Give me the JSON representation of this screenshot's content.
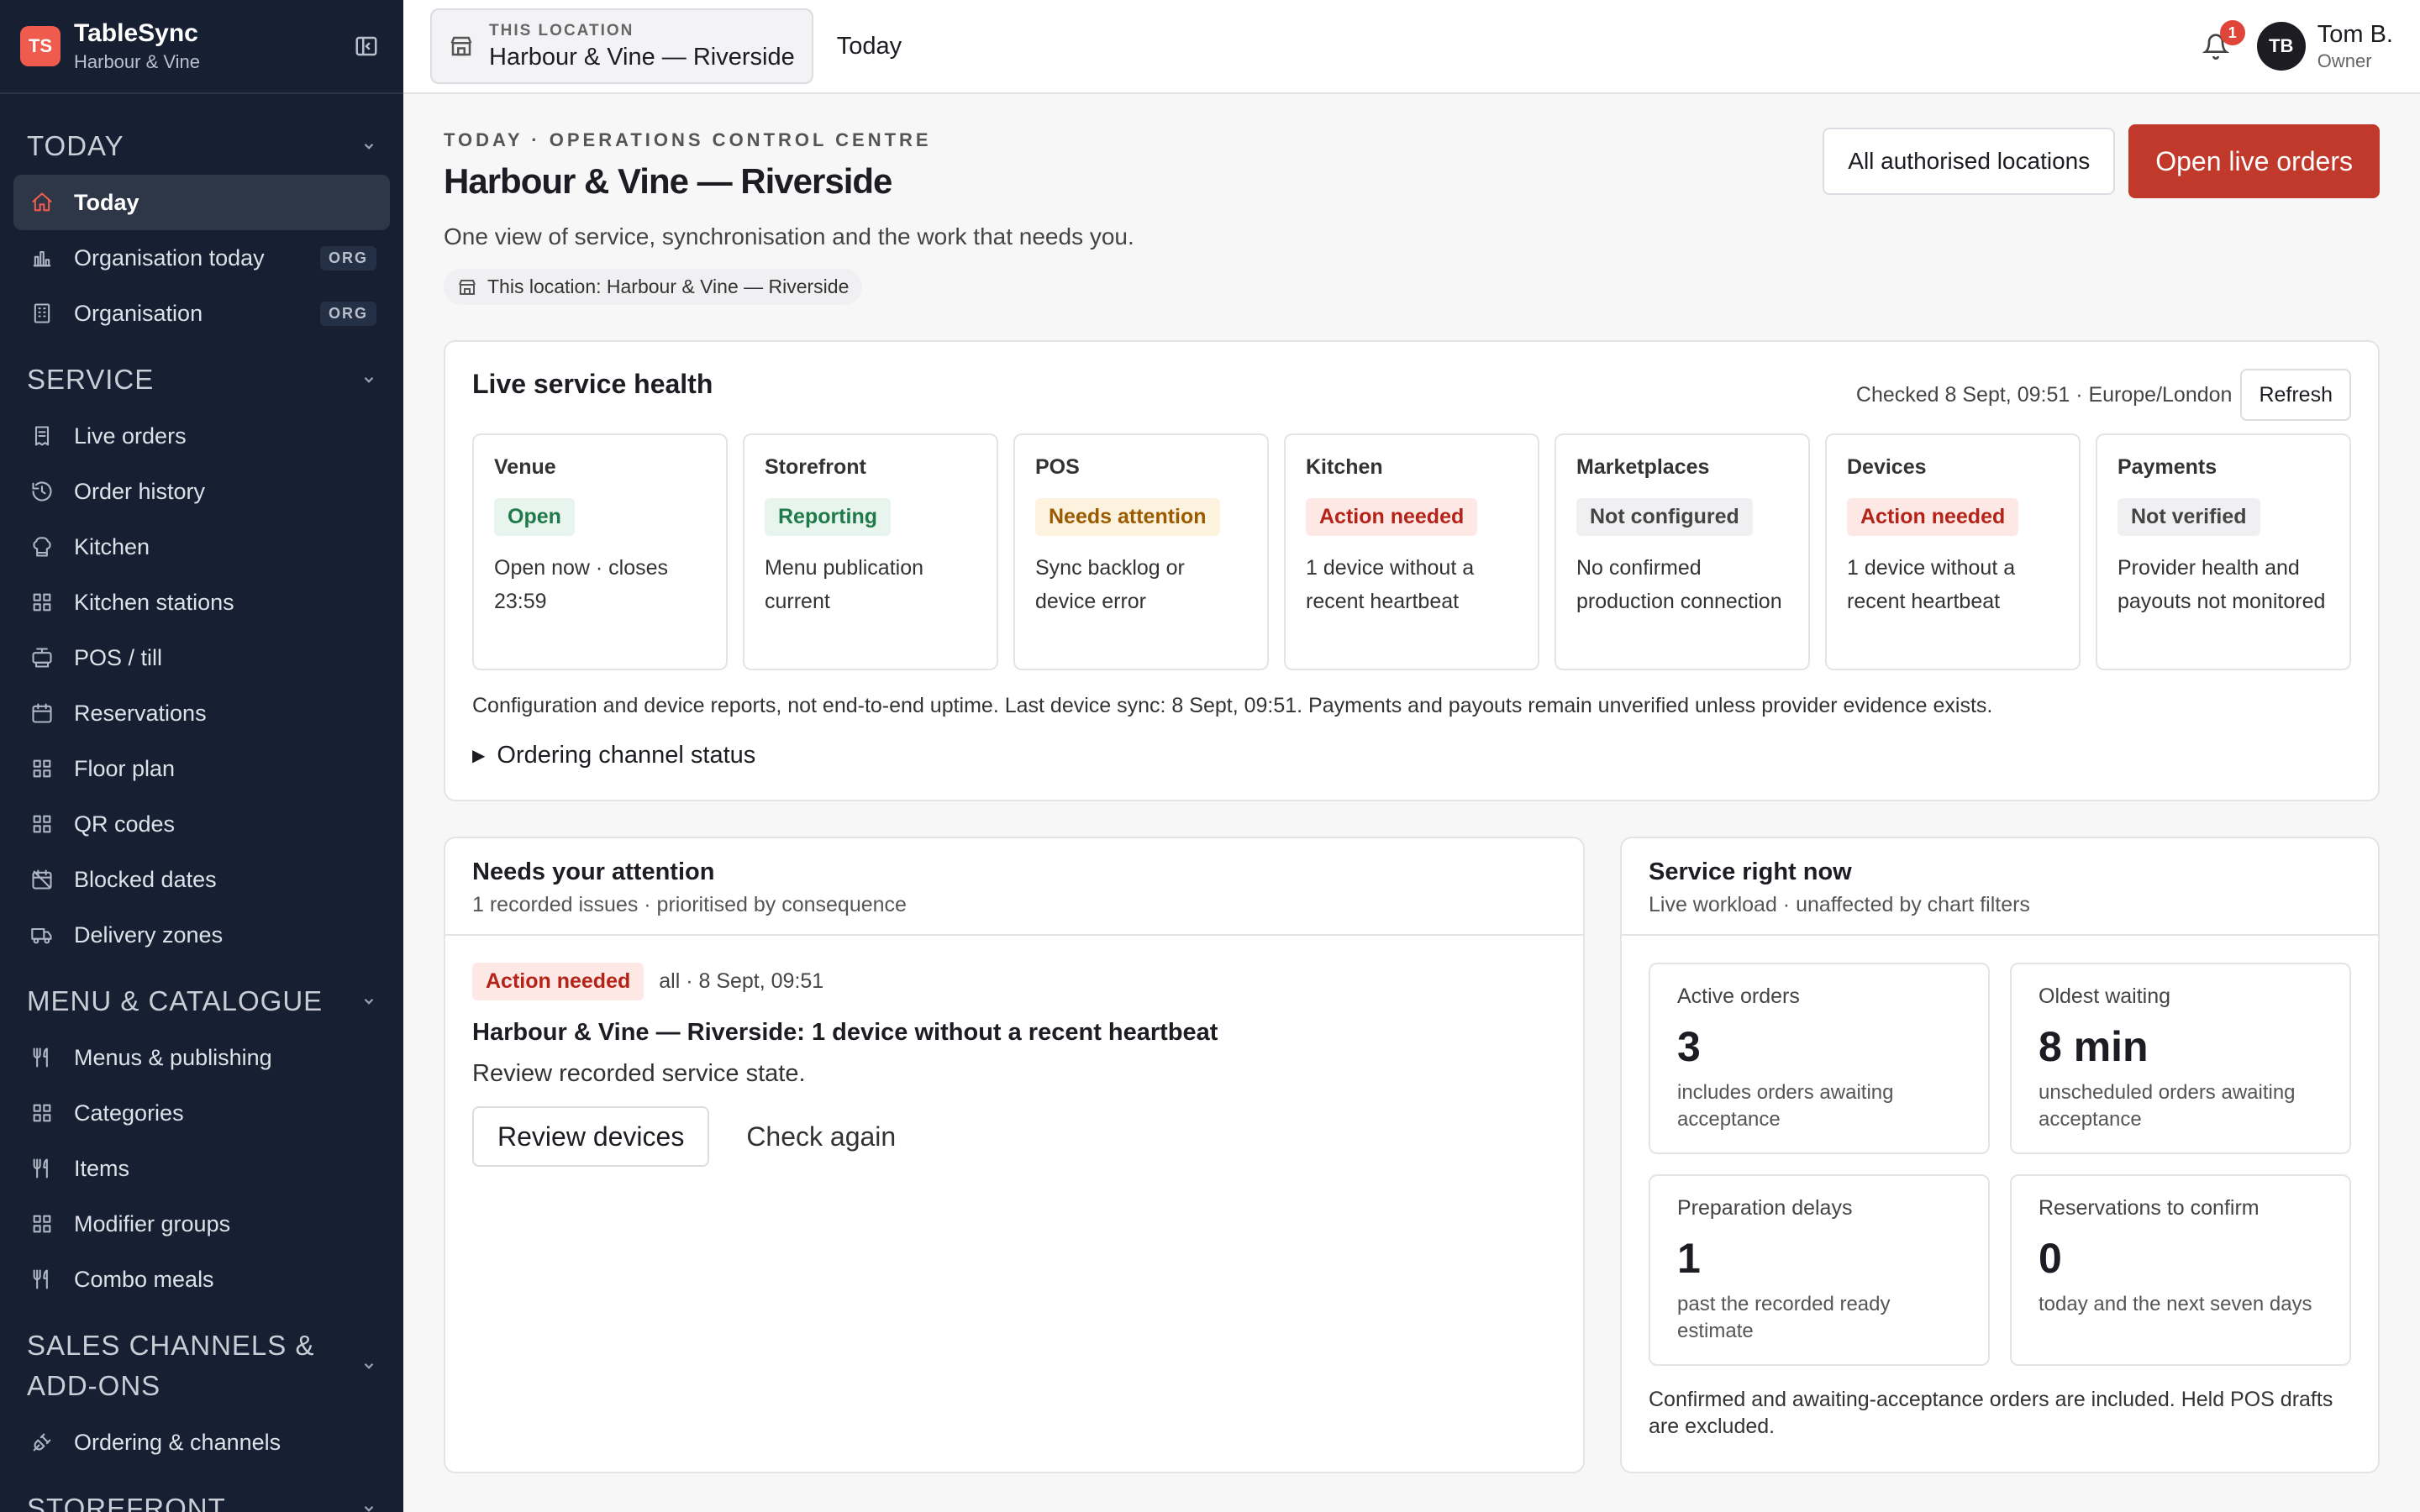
{
  "brand": {
    "initials": "TS",
    "name": "TableSync",
    "subtitle": "Harbour & Vine"
  },
  "sidebar": {
    "sections": [
      {
        "title": "TODAY",
        "items": [
          {
            "label": "Today",
            "icon": "home-icon",
            "active": true
          },
          {
            "label": "Organisation today",
            "icon": "bar-chart-icon",
            "badge": "ORG"
          },
          {
            "label": "Organisation",
            "icon": "building-icon",
            "badge": "ORG"
          }
        ]
      },
      {
        "title": "SERVICE",
        "items": [
          {
            "label": "Live orders",
            "icon": "receipt-icon"
          },
          {
            "label": "Order history",
            "icon": "history-icon"
          },
          {
            "label": "Kitchen",
            "icon": "chef-hat-icon"
          },
          {
            "label": "Kitchen stations",
            "icon": "grid-icon"
          },
          {
            "label": "POS / till",
            "icon": "till-icon"
          },
          {
            "label": "Reservations",
            "icon": "calendar-icon"
          },
          {
            "label": "Floor plan",
            "icon": "grid-icon"
          },
          {
            "label": "QR codes",
            "icon": "grid-icon"
          },
          {
            "label": "Blocked dates",
            "icon": "calendar-off-icon"
          },
          {
            "label": "Delivery zones",
            "icon": "truck-icon"
          }
        ]
      },
      {
        "title": "MENU & CATALOGUE",
        "items": [
          {
            "label": "Menus & publishing",
            "icon": "utensils-icon"
          },
          {
            "label": "Categories",
            "icon": "grid-icon"
          },
          {
            "label": "Items",
            "icon": "utensils-icon"
          },
          {
            "label": "Modifier groups",
            "icon": "grid-icon"
          },
          {
            "label": "Combo meals",
            "icon": "utensils-icon"
          }
        ]
      },
      {
        "title": "SALES CHANNELS & ADD-ONS",
        "items": [
          {
            "label": "Ordering & channels",
            "icon": "plug-icon"
          }
        ]
      },
      {
        "title": "STOREFRONT",
        "items": []
      }
    ]
  },
  "topbar": {
    "location_caption": "THIS LOCATION",
    "location_name": "Harbour & Vine — Riverside",
    "crumb": "Today",
    "notification_count": "1",
    "user_initials": "TB",
    "user_name": "Tom B.",
    "user_role": "Owner"
  },
  "page": {
    "eyebrow": "TODAY · OPERATIONS CONTROL CENTRE",
    "title": "Harbour & Vine — Riverside",
    "subtitle": "One view of service, synchronisation and the work that needs you.",
    "scope_chip": "This location: Harbour & Vine — Riverside",
    "btn_locations": "All authorised locations",
    "btn_live_orders": "Open live orders"
  },
  "health": {
    "title": "Live service health",
    "checked": "Checked 8 Sept, 09:51 · Europe/London",
    "refresh": "Refresh",
    "tiles": [
      {
        "name": "Venue",
        "status": "Open",
        "tone": "green",
        "desc": "Open now · closes 23:59"
      },
      {
        "name": "Storefront",
        "status": "Reporting",
        "tone": "green",
        "desc": "Menu publication current"
      },
      {
        "name": "POS",
        "status": "Needs attention",
        "tone": "amber",
        "desc": "Sync backlog or device error"
      },
      {
        "name": "Kitchen",
        "status": "Action needed",
        "tone": "red",
        "desc": "1 device without a recent heartbeat"
      },
      {
        "name": "Marketplaces",
        "status": "Not configured",
        "tone": "grey",
        "desc": "No confirmed production connection"
      },
      {
        "name": "Devices",
        "status": "Action needed",
        "tone": "red",
        "desc": "1 device without a recent heartbeat"
      },
      {
        "name": "Payments",
        "status": "Not verified",
        "tone": "grey",
        "desc": "Provider health and payouts not monitored"
      }
    ],
    "note": "Configuration and device reports, not end-to-end uptime. Last device sync: 8 Sept, 09:51. Payments and payouts remain unverified unless provider evidence exists.",
    "channel_toggle": "Ordering channel status"
  },
  "attention": {
    "title": "Needs your attention",
    "subtitle": "1 recorded issues · prioritised by consequence",
    "issue": {
      "status": "Action needed",
      "when": "all · 8 Sept, 09:51",
      "title": "Harbour & Vine — Riverside: 1 device without a recent heartbeat",
      "desc": "Review recorded service state.",
      "btn_primary": "Review devices",
      "btn_secondary": "Check again"
    }
  },
  "service": {
    "title": "Service right now",
    "subtitle": "Live workload · unaffected by chart filters",
    "stats": [
      {
        "label": "Active orders",
        "value": "3",
        "note": "includes orders awaiting acceptance"
      },
      {
        "label": "Oldest waiting",
        "value": "8 min",
        "note": "unscheduled orders awaiting acceptance"
      },
      {
        "label": "Preparation delays",
        "value": "1",
        "note": "past the recorded ready estimate"
      },
      {
        "label": "Reservations to confirm",
        "value": "0",
        "note": "today and the next seven days"
      }
    ],
    "footnote": "Confirmed and awaiting-acceptance orders are included. Held POS drafts are excluded."
  },
  "colors": {
    "accent": "#c0392b",
    "sidebar": "#172033",
    "brand": "#ef5b4c"
  }
}
